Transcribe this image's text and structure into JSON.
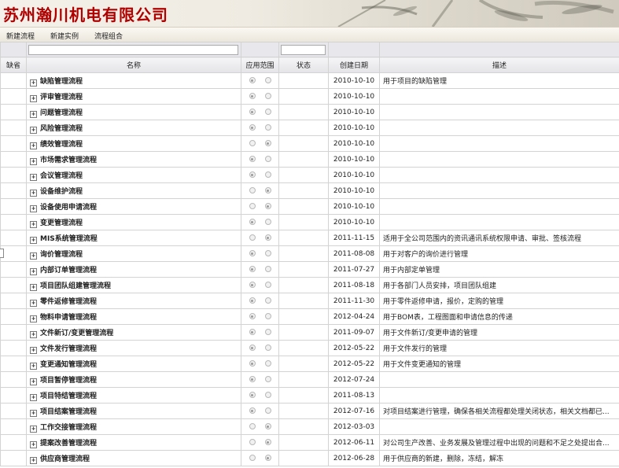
{
  "brand": {
    "title": "苏州瀚川机电有限公司"
  },
  "toolbar": {
    "items": [
      "新建流程",
      "新建实例",
      "流程组合"
    ]
  },
  "columns": {
    "missing": "缺省",
    "name": "名称",
    "scope": "应用范围",
    "status": "状态",
    "created": "创建日期",
    "desc": "描述"
  },
  "colors": {
    "brand_red": "#b00000",
    "header_bg": "#e4e4e8",
    "grid_border": "#d3d3d3"
  },
  "rows": [
    {
      "name": "缺陷管理流程",
      "scope": 0,
      "date": "2010-10-10",
      "desc": "用于项目的缺陷管理"
    },
    {
      "name": "评审管理流程",
      "scope": 0,
      "date": "2010-10-10",
      "desc": ""
    },
    {
      "name": "问题管理流程",
      "scope": 0,
      "date": "2010-10-10",
      "desc": ""
    },
    {
      "name": "风险管理流程",
      "scope": 0,
      "date": "2010-10-10",
      "desc": ""
    },
    {
      "name": "绩效管理流程",
      "scope": 1,
      "date": "2010-10-10",
      "desc": ""
    },
    {
      "name": "市场需求管理流程",
      "scope": 0,
      "date": "2010-10-10",
      "desc": ""
    },
    {
      "name": "会议管理流程",
      "scope": 0,
      "date": "2010-10-10",
      "desc": ""
    },
    {
      "name": "设备维护流程",
      "scope": 1,
      "date": "2010-10-10",
      "desc": ""
    },
    {
      "name": "设备使用申请流程",
      "scope": 1,
      "date": "2010-10-10",
      "desc": ""
    },
    {
      "name": "变更管理流程",
      "scope": 0,
      "date": "2010-10-10",
      "desc": ""
    },
    {
      "name": "MIS系统管理流程",
      "scope": 1,
      "date": "2011-11-15",
      "desc": "适用于全公司范围内的资讯通讯系统权限申请、审批、签核流程"
    },
    {
      "name": "询价管理流程",
      "scope": 0,
      "date": "2011-08-08",
      "desc": "用于对客户的询价进行管理"
    },
    {
      "name": "内部订单管理流程",
      "scope": 0,
      "date": "2011-07-27",
      "desc": "用于内部定单管理"
    },
    {
      "name": "项目团队组建管理流程",
      "scope": 0,
      "date": "2011-08-18",
      "desc": "用于各部门人员安排，项目团队组建"
    },
    {
      "name": "零件返修管理流程",
      "scope": 0,
      "date": "2011-11-30",
      "desc": "用于零件返修申请，报价，定购的管理"
    },
    {
      "name": "物料申请管理流程",
      "scope": 0,
      "date": "2012-04-24",
      "desc": "用于BOM表，工程图面和申请信息的传递"
    },
    {
      "name": "文件新订/变更管理流程",
      "scope": 0,
      "date": "2011-09-07",
      "desc": "用于文件新订/变更申请的管理"
    },
    {
      "name": "文件发行管理流程",
      "scope": 0,
      "date": "2012-05-22",
      "desc": "用于文件发行的管理"
    },
    {
      "name": "变更通知管理流程",
      "scope": 0,
      "date": "2012-05-22",
      "desc": "用于文件变更通知的管理"
    },
    {
      "name": "项目暂停管理流程",
      "scope": 0,
      "date": "2012-07-24",
      "desc": ""
    },
    {
      "name": "项目特结管理流程",
      "scope": 0,
      "date": "2011-08-13",
      "desc": ""
    },
    {
      "name": "项目结案管理流程",
      "scope": 0,
      "date": "2012-07-16",
      "desc": "对项目结案进行管理，确保各相关流程都处理关闭状态，相关文档都已..."
    },
    {
      "name": "工作交接管理流程",
      "scope": 1,
      "date": "2012-03-03",
      "desc": ""
    },
    {
      "name": "提案改善管理流程",
      "scope": 1,
      "date": "2012-06-11",
      "desc": "对公司生产改善、业务发展及管理过程中出现的问题和不足之处提出合..."
    },
    {
      "name": "供应商管理流程",
      "scope": 1,
      "date": "2012-06-28",
      "desc": "用于供应商的新建，删除，冻结，解冻"
    }
  ]
}
